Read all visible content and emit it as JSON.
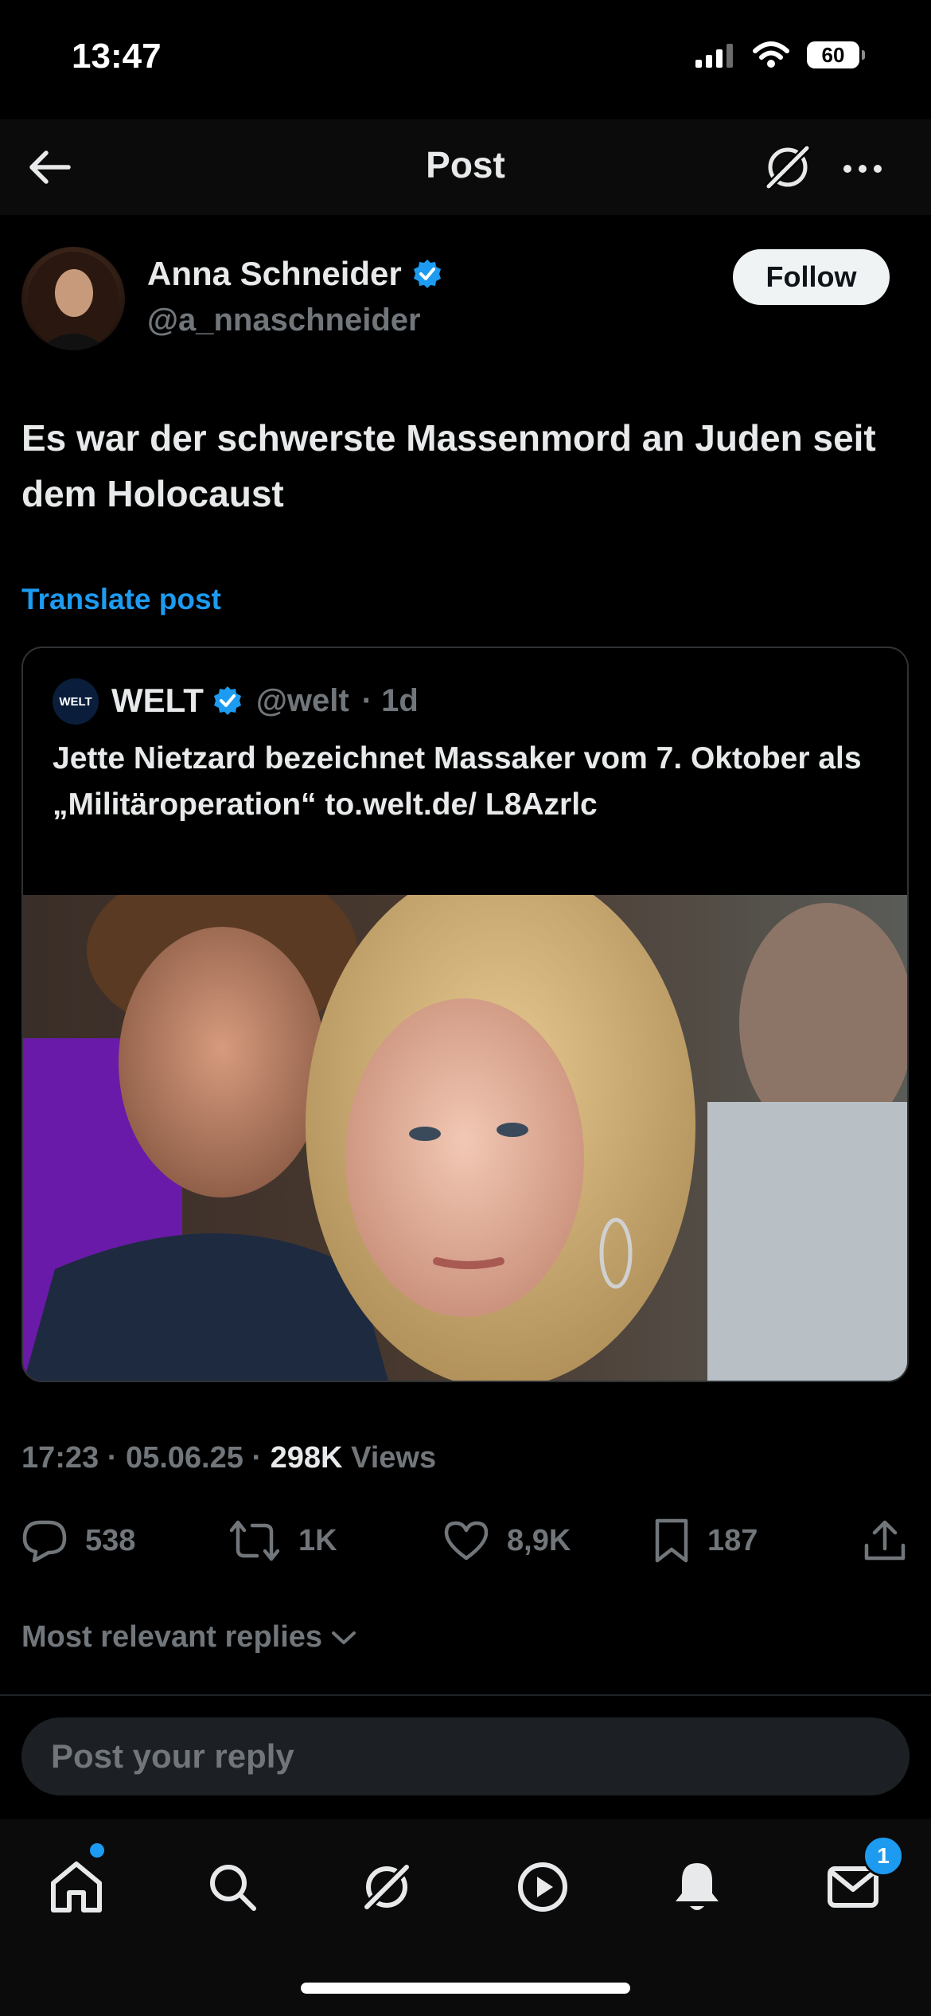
{
  "status": {
    "time": "13:47",
    "battery": "60"
  },
  "header": {
    "title": "Post"
  },
  "author": {
    "name": "Anna Schneider",
    "handle": "@a_nnaschneider",
    "follow_label": "Follow"
  },
  "post": {
    "text": "Es war der schwerste Massenmord an Juden seit dem Holocaust",
    "translate_label": "Translate post",
    "timestamp": "17:23 · 05.06.25 ·",
    "views_count": "298K",
    "views_label": "Views"
  },
  "quote": {
    "avatar_text": "WELT",
    "name": "WELT",
    "handle": "@welt",
    "time": "· 1d",
    "text": "Jette Nietzard bezeichnet Massaker vom 7. Oktober als „Militäroperation“ to.welt.de/ L8Azrlc"
  },
  "actions": {
    "replies": "538",
    "reposts": "1K",
    "likes": "8,9K",
    "bookmarks": "187"
  },
  "replies_sort_label": "Most relevant replies",
  "reply": {
    "placeholder": "Post your reply"
  },
  "tabbar": {
    "messages_badge": "1"
  },
  "colors": {
    "accent": "#1d9bf0",
    "background": "#000000",
    "muted": "#71767b"
  }
}
